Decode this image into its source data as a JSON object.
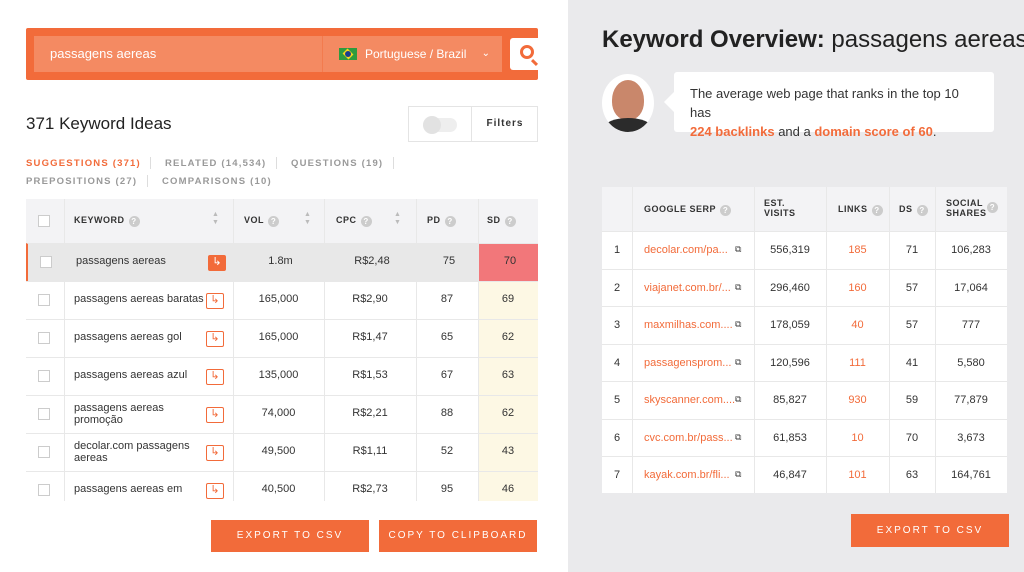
{
  "search": {
    "query": "passagens aereas",
    "language": "Portuguese / Brazil"
  },
  "ideas_title": "371 Keyword Ideas",
  "filters_label": "Filters",
  "tabs": [
    {
      "label": "SUGGESTIONS (371)",
      "active": true
    },
    {
      "label": "RELATED (14,534)",
      "active": false
    },
    {
      "label": "QUESTIONS (19)",
      "active": false
    },
    {
      "label": "PREPOSITIONS (27)",
      "active": false
    },
    {
      "label": "COMPARISONS (10)",
      "active": false
    }
  ],
  "keyword_table": {
    "headers": {
      "keyword": "KEYWORD",
      "vol": "VOL",
      "cpc": "CPC",
      "pd": "PD",
      "sd": "SD"
    },
    "rows": [
      {
        "keyword": "passagens aereas",
        "vol": "1.8m",
        "cpc": "R$2,48",
        "pd": "75",
        "sd": "70"
      },
      {
        "keyword": "passagens aereas baratas",
        "vol": "165,000",
        "cpc": "R$2,90",
        "pd": "87",
        "sd": "69"
      },
      {
        "keyword": "passagens aereas gol",
        "vol": "165,000",
        "cpc": "R$1,47",
        "pd": "65",
        "sd": "62"
      },
      {
        "keyword": "passagens aereas azul",
        "vol": "135,000",
        "cpc": "R$1,53",
        "pd": "67",
        "sd": "63"
      },
      {
        "keyword": "passagens aereas promoção",
        "vol": "74,000",
        "cpc": "R$2,21",
        "pd": "88",
        "sd": "62"
      },
      {
        "keyword": "decolar.com passagens aereas",
        "vol": "49,500",
        "cpc": "R$1,11",
        "pd": "52",
        "sd": "43"
      },
      {
        "keyword": "passagens aereas em",
        "vol": "40,500",
        "cpc": "R$2,73",
        "pd": "95",
        "sd": "46"
      }
    ]
  },
  "left_buttons": {
    "export": "EXPORT TO CSV",
    "copy": "COPY TO CLIPBOARD"
  },
  "overview": {
    "title_bold": "Keyword Overview:",
    "title_keyword": "passagens aereas",
    "bubble_intro": "The average web page that ranks in the top 10 has",
    "backlinks": "224 backlinks",
    "bubble_mid": "and a",
    "domain_score": "domain score of 60",
    "bubble_end": "."
  },
  "serp_table": {
    "headers": {
      "serp": "GOOGLE SERP",
      "visits_1": "EST.",
      "visits_2": "VISITS",
      "links": "LINKS",
      "ds": "DS",
      "shares_1": "SOCIAL",
      "shares_2": "SHARES"
    },
    "rows": [
      {
        "rank": "1",
        "url": "decolar.com/pa...",
        "visits": "556,319",
        "links": "185",
        "ds": "71",
        "shares": "106,283"
      },
      {
        "rank": "2",
        "url": "viajanet.com.br/...",
        "visits": "296,460",
        "links": "160",
        "ds": "57",
        "shares": "17,064"
      },
      {
        "rank": "3",
        "url": "maxmilhas.com....",
        "visits": "178,059",
        "links": "40",
        "ds": "57",
        "shares": "777"
      },
      {
        "rank": "4",
        "url": "passagensprom...",
        "visits": "120,596",
        "links": "111",
        "ds": "41",
        "shares": "5,580"
      },
      {
        "rank": "5",
        "url": "skyscanner.com....",
        "visits": "85,827",
        "links": "930",
        "ds": "59",
        "shares": "77,879"
      },
      {
        "rank": "6",
        "url": "cvc.com.br/pass...",
        "visits": "61,853",
        "links": "10",
        "ds": "70",
        "shares": "3,673"
      },
      {
        "rank": "7",
        "url": "kayak.com.br/fli...",
        "visits": "46,847",
        "links": "101",
        "ds": "63",
        "shares": "164,761"
      }
    ]
  },
  "right_button": {
    "export": "EXPORT TO CSV"
  },
  "colors": {
    "accent": "#f26b3a",
    "sd_high": "#f2777a",
    "sd_col": "#fdf8e4",
    "panel_bg": "#eaeaec"
  }
}
